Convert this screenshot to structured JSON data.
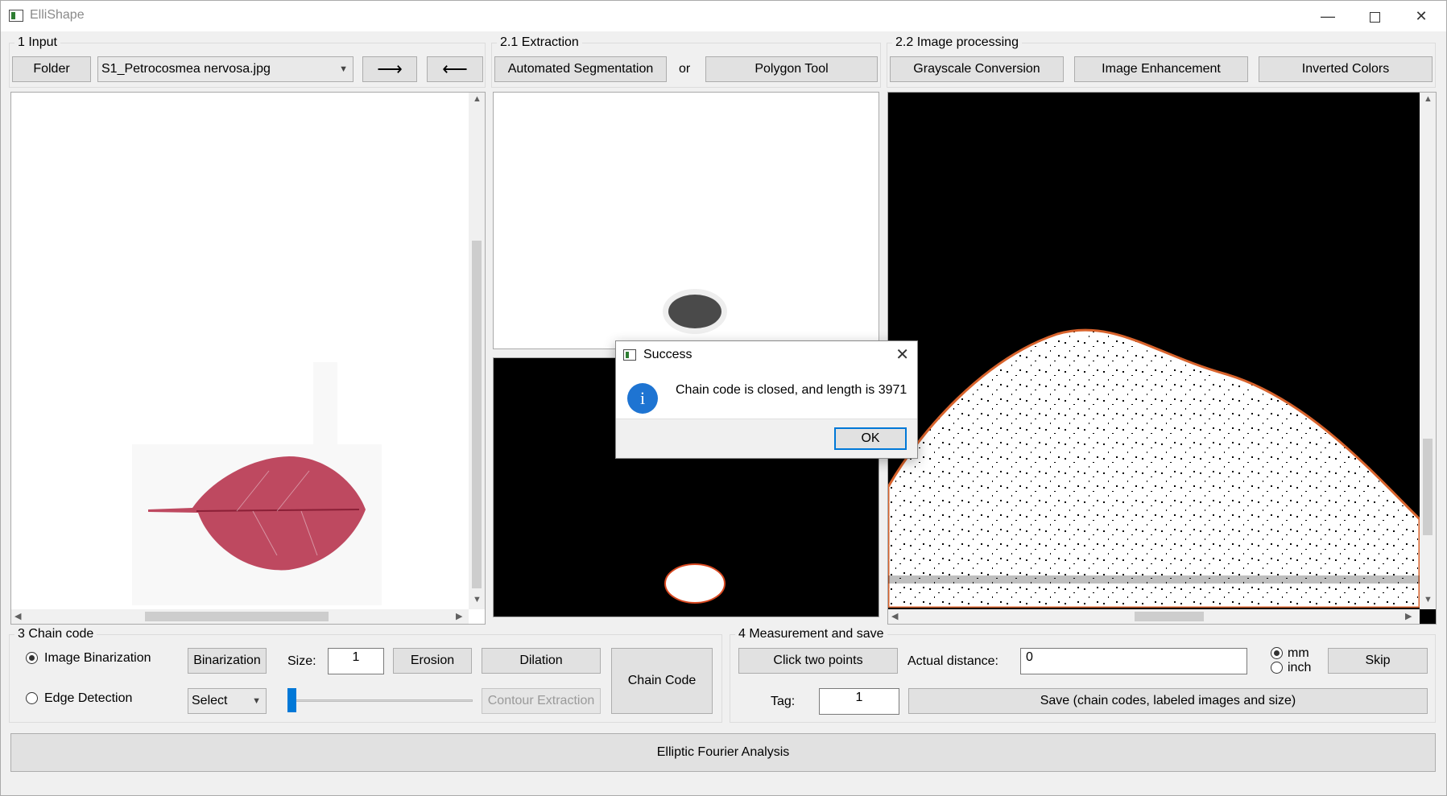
{
  "window": {
    "title": "ElliShape",
    "minimize": "—",
    "close": "✕"
  },
  "input": {
    "group_title": "1 Input",
    "folder_button": "Folder",
    "file_select": "S1_Petrocosmea nervosa.jpg",
    "next_button": "⟶",
    "prev_button": "⟵"
  },
  "extraction": {
    "group_title": "2.1 Extraction",
    "auto_seg_button": "Automated Segmentation",
    "or_text": "or",
    "polygon_button": "Polygon Tool"
  },
  "processing": {
    "group_title": "2.2 Image processing",
    "grayscale_button": "Grayscale Conversion",
    "enhancement_button": "Image Enhancement",
    "invert_button": "Inverted Colors"
  },
  "chain_code": {
    "group_title": "3 Chain code",
    "radio_binarization": "Image Binarization",
    "radio_binarization_checked": true,
    "radio_edge": "Edge Detection",
    "radio_edge_checked": false,
    "binarization_button": "Binarization",
    "size_label": "Size:",
    "size_value": "1",
    "erosion_button": "Erosion",
    "dilation_button": "Dilation",
    "edge_select": "Select",
    "contour_button": "Contour Extraction",
    "chain_code_button": "Chain Code",
    "slider_value": 0
  },
  "measurement": {
    "group_title": "4 Measurement and save",
    "click_points_button": "Click two points",
    "actual_distance_label": "Actual distance:",
    "actual_distance_value": "0",
    "unit_mm": "mm",
    "unit_mm_checked": true,
    "unit_inch": "inch",
    "unit_inch_checked": false,
    "skip_button": "Skip",
    "tag_label": "Tag:",
    "tag_value": "1",
    "save_button": "Save (chain codes, labeled images and size)"
  },
  "efa_button": "Elliptic Fourier Analysis",
  "dialog": {
    "title": "Success",
    "message": "Chain code is closed, and length is 3971",
    "ok_button": "OK",
    "close_icon": "✕",
    "info_glyph": "i"
  },
  "colors": {
    "leaf": "#b83a52",
    "accent": "#0078d7",
    "info_blue": "#1e74d2"
  }
}
